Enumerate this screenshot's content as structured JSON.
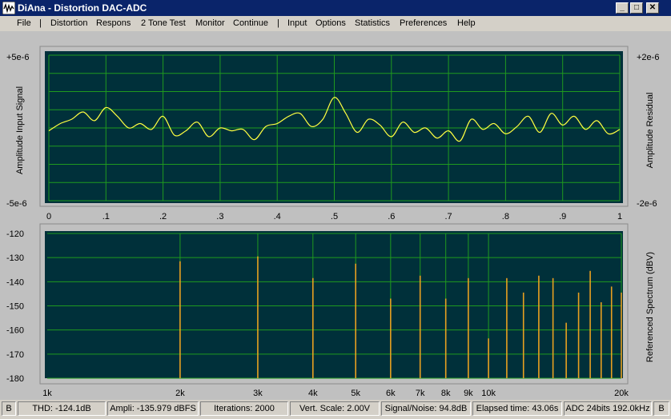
{
  "window": {
    "title": "DiAna - Distortion DAC-ADC"
  },
  "menu": [
    "File",
    "|",
    "Distortion",
    "Respons",
    "2 Tone Test",
    "Monitor",
    "Continue",
    "|",
    "Input",
    "Options",
    "Statistics",
    "Preferences",
    "Help"
  ],
  "top_plot": {
    "y_left_top": "+5e-6",
    "y_left_bottom": "-5e-6",
    "y_right_top": "+2e-6",
    "y_right_bottom": "-2e-6",
    "y_left_label": "Amplitude Input Signal",
    "y_right_label": "Amplitude Residual",
    "x_ticks": [
      "0",
      ".1",
      ".2",
      ".3",
      ".4",
      ".5",
      ".6",
      ".7",
      ".8",
      ".9",
      "1"
    ]
  },
  "bottom_plot": {
    "y_ticks": [
      "-120",
      "-130",
      "-140",
      "-150",
      "-160",
      "-170",
      "-180"
    ],
    "y_right_label": "Referenced Spectrum (dBV)",
    "x_ticks": [
      "1k",
      "2k",
      "3k",
      "4k",
      "5k",
      "6k",
      "7k",
      "8k",
      "9k",
      "10k",
      "20k"
    ]
  },
  "status": [
    "B",
    "THD: -124.1dB",
    "Ampli: -135.979 dBFS",
    "Iterations: 2000",
    "Vert. Scale: 2.00V",
    "Signal/Noise:  94.8dB",
    "Elapsed time: 43.06s",
    "ADC 24bits 192.0kHz",
    "B"
  ],
  "colors": {
    "plot_bg": "#00303a",
    "grid": "#1f9a1f",
    "trace": "#ffff40",
    "spectrum": "#e8a020",
    "titlebar": "#0a246a"
  },
  "chart_data": [
    {
      "type": "line",
      "title": "",
      "xlabel": "",
      "ylabel": "Amplitude Input Signal",
      "xlim": [
        0,
        1
      ],
      "ylim": [
        -5e-06,
        5e-06
      ],
      "grid": true,
      "series": [
        {
          "x": [
            0,
            0.02,
            0.04,
            0.06,
            0.08,
            0.1,
            0.12,
            0.14,
            0.16,
            0.18,
            0.2,
            0.22,
            0.24,
            0.26,
            0.28,
            0.3,
            0.32,
            0.34,
            0.36,
            0.38,
            0.4,
            0.42,
            0.44,
            0.46,
            0.48,
            0.5,
            0.52,
            0.54,
            0.56,
            0.58,
            0.6,
            0.62,
            0.64,
            0.66,
            0.68,
            0.7,
            0.72,
            0.74,
            0.76,
            0.78,
            0.8,
            0.82,
            0.84,
            0.86,
            0.88,
            0.9,
            0.92,
            0.94,
            0.96,
            0.98,
            1
          ],
          "values": [
            -2e-07,
            3e-07,
            6e-07,
            1.1e-06,
            5e-07,
            1.4e-06,
            8e-07,
            0.0,
            3e-07,
            -1e-07,
            8e-07,
            -5e-07,
            -2e-07,
            4e-07,
            -6e-07,
            0.0,
            -2e-07,
            -1e-07,
            -8e-07,
            1e-07,
            3e-07,
            8e-07,
            1e-06,
            1e-07,
            6e-07,
            2.1e-06,
            1e-06,
            -3e-07,
            6e-07,
            2e-07,
            -6e-07,
            4e-07,
            -3e-07,
            0.0,
            -7e-07,
            -2e-07,
            -9e-07,
            6e-07,
            -1e-07,
            3e-07,
            -4e-07,
            1e-07,
            8e-07,
            -3e-07,
            1e-06,
            2e-07,
            8e-07,
            -1e-07,
            5e-07,
            -4e-07,
            -1e-07
          ]
        }
      ]
    },
    {
      "type": "bar",
      "title": "",
      "xlabel": "",
      "ylabel": "Referenced Spectrum (dBV)",
      "x_scale": "log",
      "xlim": [
        1000,
        20000
      ],
      "ylim": [
        -180,
        -120
      ],
      "grid": true,
      "x": [
        2000,
        3000,
        4000,
        5000,
        6000,
        7000,
        8000,
        9000,
        10000,
        11000,
        12000,
        13000,
        14000,
        15000,
        16000,
        17000,
        18000,
        19000,
        20000
      ],
      "values": [
        -131.5,
        -129.5,
        -138.5,
        -132.5,
        -147,
        -137.5,
        -147,
        -138.5,
        -163.5,
        -138.5,
        -144.5,
        -137.5,
        -138.5,
        -157,
        -144.5,
        -135.5,
        -148.5,
        -142,
        -144.5
      ]
    }
  ]
}
